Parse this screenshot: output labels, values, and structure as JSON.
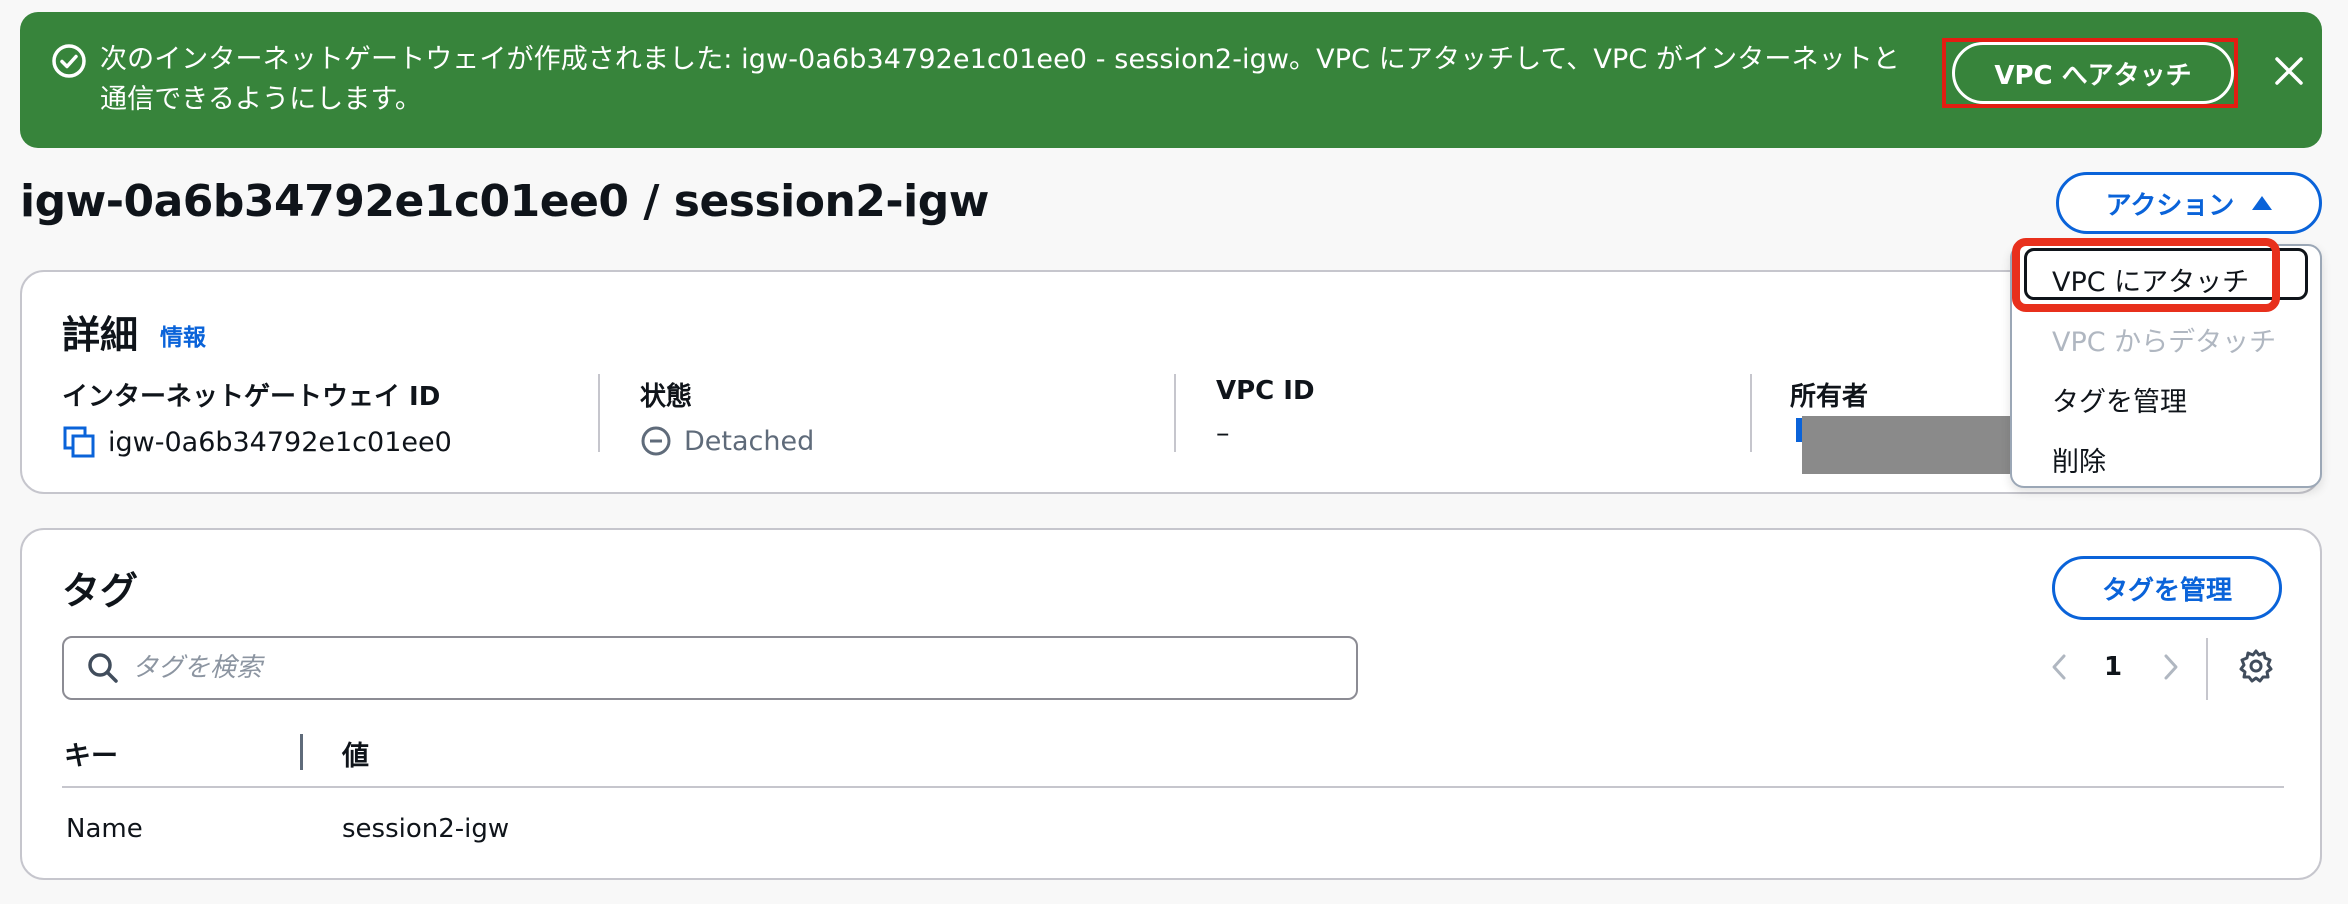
{
  "flash": {
    "message": "次のインターネットゲートウェイが作成されました: igw-0a6b34792e1c01ee0 - session2-igw。VPC にアタッチして、VPC がインターネットと通信できるようにします。",
    "action_label": "VPC へアタッチ",
    "color": "#37843b"
  },
  "header": {
    "title": "igw-0a6b34792e1c01ee0 / session2-igw",
    "actions_label": "アクション"
  },
  "dropdown": {
    "items": [
      {
        "label": "VPC にアタッチ",
        "enabled": true
      },
      {
        "label": "VPC からデタッチ",
        "enabled": false
      },
      {
        "label": "タグを管理",
        "enabled": true
      },
      {
        "label": "削除",
        "enabled": true
      }
    ]
  },
  "details": {
    "title": "詳細",
    "info_label": "情報",
    "igw_id_label": "インターネットゲートウェイ ID",
    "igw_id_value": "igw-0a6b34792e1c01ee0",
    "state_label": "状態",
    "state_value": "Detached",
    "vpc_id_label": "VPC ID",
    "vpc_id_value": "–",
    "owner_label": "所有者"
  },
  "tags": {
    "title": "タグ",
    "manage_label": "タグを管理",
    "search_placeholder": "タグを検索",
    "page_number": "1",
    "columns": [
      "キー",
      "値"
    ],
    "rows": [
      {
        "key": "Name",
        "value": "session2-igw"
      }
    ]
  },
  "colors": {
    "accent": "#0a63d9",
    "highlight_red": "#e21d12"
  }
}
